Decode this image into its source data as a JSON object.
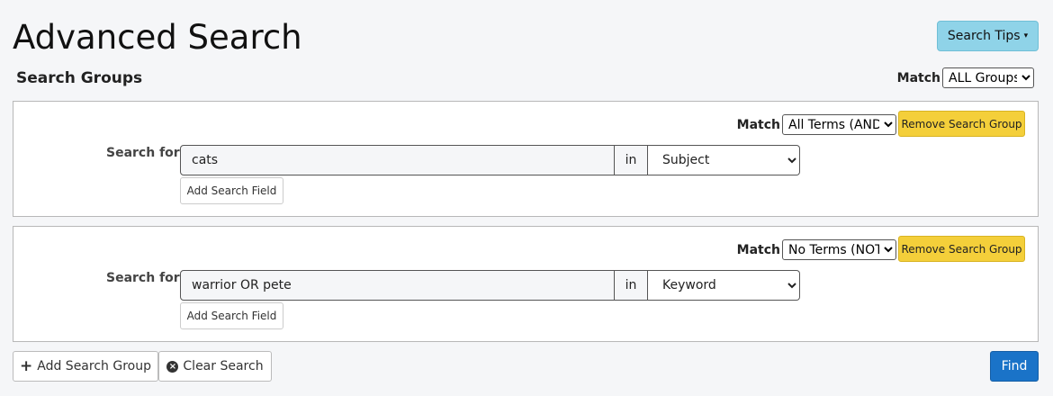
{
  "header": {
    "title": "Advanced Search",
    "tips_label": "Search Tips",
    "tips_caret": "▾"
  },
  "groups_section": {
    "heading": "Search Groups",
    "match_label": "Match",
    "match_value": "ALL Groups"
  },
  "groups": [
    {
      "match_label": "Match",
      "match_value": "All Terms (AND)",
      "remove_label": "Remove Search Group",
      "search_for_label": "Search for",
      "term_value": "cats",
      "in_label": "in",
      "field_value": "Subject",
      "add_field_label": "Add Search Field"
    },
    {
      "match_label": "Match",
      "match_value": "No Terms (NOT)",
      "remove_label": "Remove Search Group",
      "search_for_label": "Search for",
      "term_value": "warrior OR pete",
      "in_label": "in",
      "field_value": "Keyword",
      "add_field_label": "Add Search Field"
    }
  ],
  "footer": {
    "add_group_icon": "+",
    "add_group_label": "Add Search Group",
    "clear_icon": "×",
    "clear_label": "Clear Search",
    "find_label": "Find"
  },
  "colors": {
    "tips_button": "#8fd3e8",
    "remove_button": "#f4cf3a",
    "find_button": "#1a73c8"
  }
}
